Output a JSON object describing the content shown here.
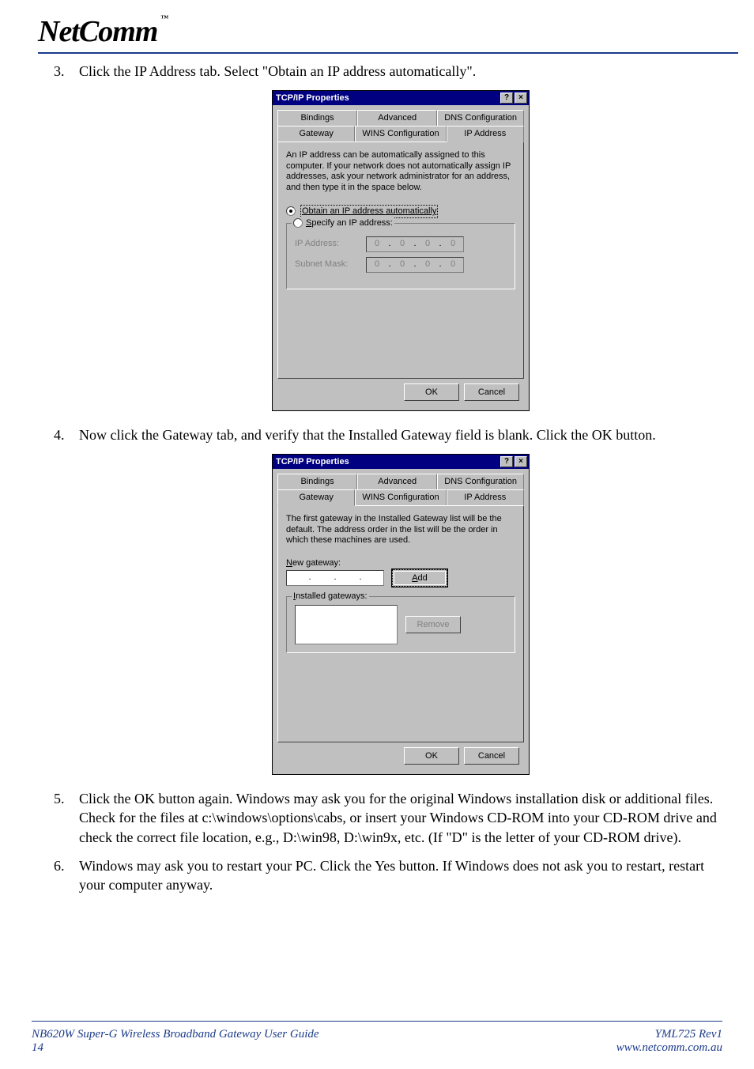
{
  "brand": {
    "logo": "NetComm",
    "tm": "™"
  },
  "steps": {
    "s3": {
      "num": "3.",
      "text": "Click the IP Address tab. Select \"Obtain an IP address automatically\"."
    },
    "s4": {
      "num": "4.",
      "text": "Now click the Gateway tab, and verify that the Installed Gateway field is blank. Click the OK button."
    },
    "s5": {
      "num": "5.",
      "text": "Click the OK button again. Windows may ask you for the original Windows installation disk or additional files. Check for the files at c:\\windows\\options\\cabs, or insert your Windows CD-ROM into your CD-ROM drive and check the correct file location, e.g., D:\\win98, D:\\win9x, etc. (If \"D\" is the letter of your CD-ROM drive)."
    },
    "s6": {
      "num": "6.",
      "text": "Windows may ask you to restart your PC. Click the Yes button. If Windows does not ask you to restart, restart your computer anyway."
    }
  },
  "dlg1": {
    "title": "TCP/IP Properties",
    "help": "?",
    "close": "×",
    "tabs": {
      "bindings": "Bindings",
      "advanced": "Advanced",
      "dns": "DNS Configuration",
      "gateway": "Gateway",
      "wins": "WINS Configuration",
      "ipaddr": "IP Address"
    },
    "desc": "An IP address can be automatically assigned to this computer. If your network does not automatically assign IP addresses, ask your network administrator for an address, and then type it in the space below.",
    "opt_auto": "Obtain an IP address automatically",
    "opt_spec": "Specify an IP address:",
    "ip_label": "IP Address:",
    "subnet_label": "Subnet Mask:",
    "ip": [
      "0",
      "0",
      "0",
      "0"
    ],
    "subnet": [
      "0",
      "0",
      "0",
      "0"
    ],
    "ok": "OK",
    "cancel": "Cancel"
  },
  "dlg2": {
    "title": "TCP/IP Properties",
    "help": "?",
    "close": "×",
    "tabs": {
      "bindings": "Bindings",
      "advanced": "Advanced",
      "dns": "DNS Configuration",
      "gateway": "Gateway",
      "wins": "WINS Configuration",
      "ipaddr": "IP Address"
    },
    "desc": "The first gateway in the Installed Gateway list will be the default. The address order in the list will be the order in which these machines are used.",
    "newgw_label": "New gateway:",
    "add": "Add",
    "installed_label": "Installed gateways:",
    "remove": "Remove",
    "ok": "OK",
    "cancel": "Cancel"
  },
  "footer": {
    "left1": "NB620W Super-G Wireless Broadband  Gateway User Guide",
    "left2": "14",
    "right1": "YML725 Rev1",
    "right2": "www.netcomm.com.au"
  }
}
